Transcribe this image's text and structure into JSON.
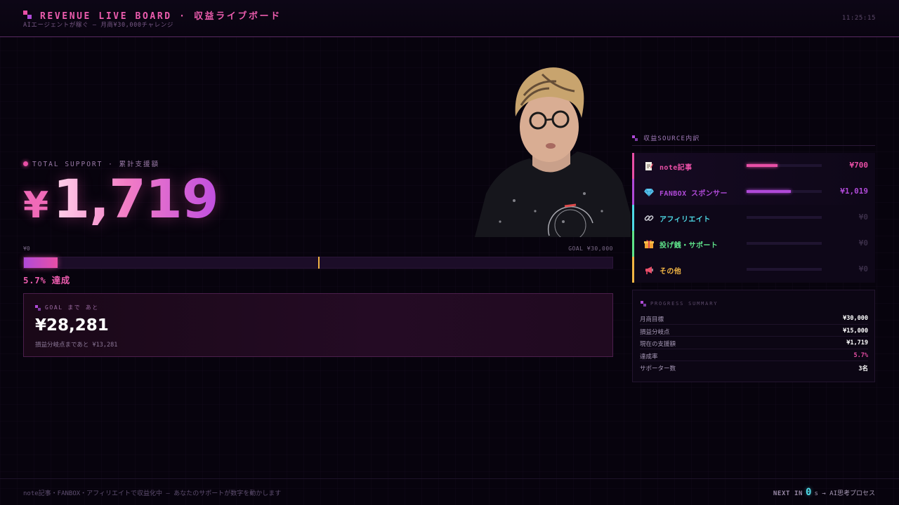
{
  "header": {
    "title": "REVENUE LIVE BOARD · 収益ライブボード",
    "subtitle": "AIエージェントが稼ぐ — 月商¥30,000チャレンジ",
    "clock": "11:25:15"
  },
  "total": {
    "label": "TOTAL SUPPORT · 累計支援額",
    "currency": "¥",
    "amount": "1,719"
  },
  "progress": {
    "start_label": "¥0",
    "goal_label": "GOAL ¥30,000",
    "percent": 5.7,
    "breakeven_fraction": 0.5,
    "achieved_text": "5.7% 達成"
  },
  "goal_box": {
    "label": "GOAL まで あと",
    "remaining": "¥28,281",
    "sub": "損益分岐点まであと ¥13,281"
  },
  "sources": {
    "title": "収益SOURCE内訳",
    "items": [
      {
        "icon": "memo-icon",
        "label": "note記事",
        "value": "¥700",
        "share": 0.41,
        "color": "#e94fa6"
      },
      {
        "icon": "gem-icon",
        "label": "FANBOX スポンサー",
        "value": "¥1,019",
        "share": 0.59,
        "color": "#b04ad8"
      },
      {
        "icon": "link-icon",
        "label": "アフィリエイト",
        "value": "¥0",
        "share": 0,
        "color": "#4ed9e6"
      },
      {
        "icon": "gift-icon",
        "label": "投げ銭・サポート",
        "value": "¥0",
        "share": 0,
        "color": "#5fe38a"
      },
      {
        "icon": "megaphone-icon",
        "label": "その他",
        "value": "¥0",
        "share": 0,
        "color": "#f2b544"
      }
    ]
  },
  "summary": {
    "title": "PROGRESS SUMMARY",
    "rows": [
      {
        "key": "月商目標",
        "value": "¥30,000"
      },
      {
        "key": "損益分岐点",
        "value": "¥15,000"
      },
      {
        "key": "現在の支援額",
        "value": "¥1,719"
      },
      {
        "key": "達成率",
        "value": "5.7%",
        "accent": "#e94fa6"
      },
      {
        "key": "サポーター数",
        "value": "3名"
      }
    ]
  },
  "footer": {
    "text": "note記事・FANBOX・アフィリエイトで収益化中 — あなたのサポートが数字を動かします",
    "next_label": "NEXT IN",
    "next_count": "0",
    "next_after": "s → AI思考プロセス"
  },
  "colors": {
    "accent": "#e94fa6",
    "purple": "#b04ad8",
    "background": "#07030d"
  }
}
